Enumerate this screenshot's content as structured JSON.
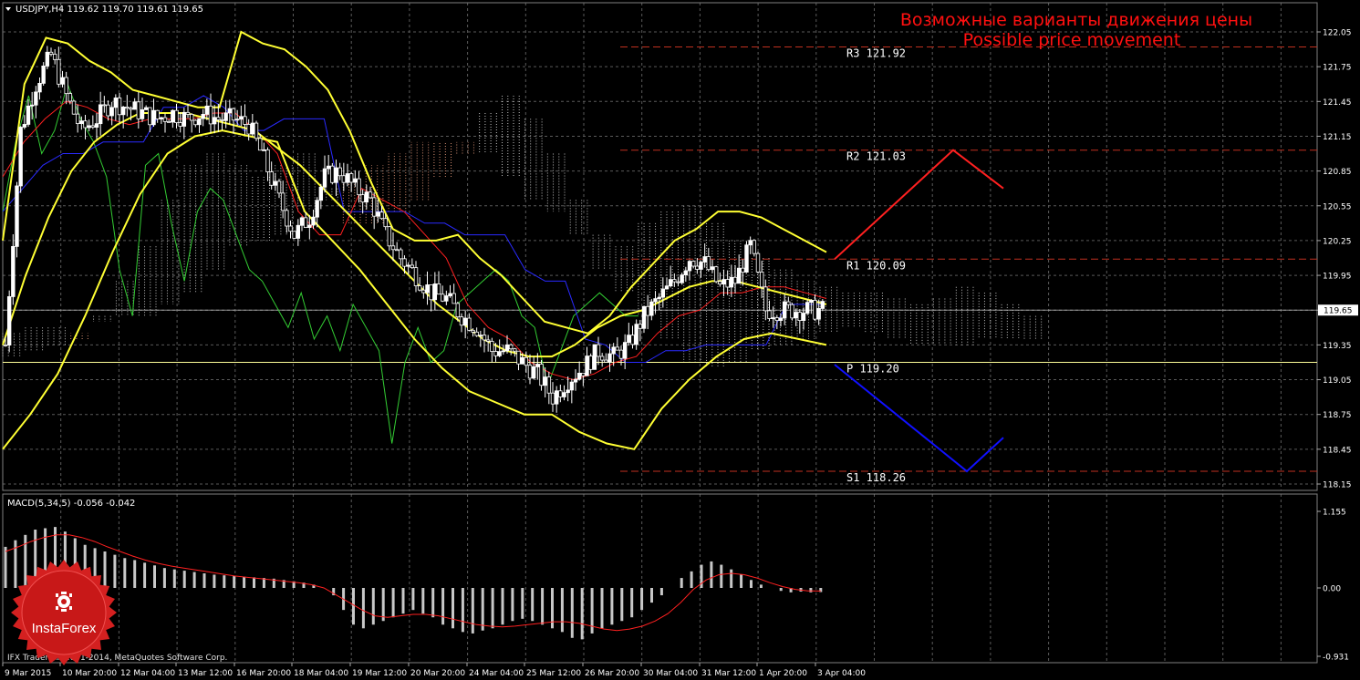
{
  "header": {
    "symbol_line": "USDJPY,H4  119.62 119.70 119.61 119.65",
    "annotation_ru": "Возможные варианты движения цены",
    "annotation_en": "Possible price movement"
  },
  "footer": {
    "copyright": "IFX Trader, © 2001-2014, MetaQuotes Software Corp.",
    "logo_text": "InstaForex"
  },
  "macd": {
    "label": "MACD(5,34,5) -0.056 -0.042",
    "y_ticks": [
      "1.155",
      "0.00",
      "-0.931"
    ],
    "y_values": [
      1.155,
      0.0,
      -0.931
    ]
  },
  "colors": {
    "background": "#000000",
    "grid": "#5a5a5a",
    "bull_candle": "#ffffff",
    "bear_candle": "#000000",
    "bollinger": "#ffff33",
    "tenkan": "#ff2020",
    "kijun": "#2a2aff",
    "chikou": "#33cc33",
    "cloud_a": "#f0a080",
    "cloud_b": "#d8d8d8",
    "level_line": "#c03020",
    "annotation": "#ff1010",
    "up_scenario": "#ff2020",
    "down_scenario": "#1010ff",
    "price_line": "#c8c8c8",
    "pivot_line": "#ffff99",
    "macd_hist": "#c8c8c8",
    "macd_signal": "#ff2020",
    "logo_red": "#d42020"
  },
  "chart_data": [
    {
      "type": "candlestick",
      "symbol": "USDJPY",
      "timeframe": "H4",
      "ohlc_current": {
        "open": 119.62,
        "high": 119.7,
        "low": 119.61,
        "close": 119.65
      },
      "current_price": 119.65,
      "current_price_label": "119.65",
      "ylim": [
        118.09,
        122.15
      ],
      "y_ticks": [
        "122.05",
        "121.75",
        "121.45",
        "121.15",
        "120.85",
        "120.55",
        "120.25",
        "119.95",
        "119.65",
        "119.35",
        "119.05",
        "118.75",
        "118.45",
        "118.15"
      ],
      "y_tick_values": [
        122.05,
        121.75,
        121.45,
        121.15,
        120.85,
        120.55,
        120.25,
        119.95,
        119.65,
        119.35,
        119.05,
        118.75,
        118.45,
        118.15
      ],
      "x_ticks": [
        "9 Mar 2015",
        "10 Mar 20:00",
        "12 Mar 04:00",
        "13 Mar 12:00",
        "16 Mar 20:00",
        "18 Mar 04:00",
        "19 Mar 12:00",
        "20 Mar 20:00",
        "24 Mar 04:00",
        "25 Mar 12:00",
        "26 Mar 20:00",
        "30 Mar 04:00",
        "31 Mar 12:00",
        "1 Apr 20:00",
        "3 Apr 04:00"
      ],
      "levels": [
        {
          "name": "R3",
          "label": "R3 121.92",
          "value": 121.92
        },
        {
          "name": "R2",
          "label": "R2 121.03",
          "value": 121.03
        },
        {
          "name": "R1",
          "label": "R1 120.09",
          "value": 120.09
        },
        {
          "name": "P",
          "label": "P 119.20",
          "value": 119.2
        },
        {
          "name": "S1",
          "label": "S1 118.26",
          "value": 118.26
        }
      ],
      "close_path": [
        119.35,
        121.2,
        121.6,
        121.85,
        121.5,
        121.2,
        121.3,
        121.45,
        121.4,
        121.35,
        121.3,
        121.35,
        121.3,
        121.35,
        121.3,
        121.3,
        121.25,
        120.95,
        120.6,
        120.3,
        120.45,
        120.8,
        120.85,
        120.7,
        120.6,
        120.3,
        120.1,
        119.95,
        119.8,
        119.75,
        119.6,
        119.5,
        119.3,
        119.3,
        119.2,
        119.1,
        118.9,
        119.05,
        119.15,
        119.3,
        119.25,
        119.35,
        119.6,
        119.75,
        119.9,
        120.1,
        120.05,
        119.85,
        119.9,
        120.2,
        119.65,
        119.65,
        119.65,
        119.65,
        119.65
      ],
      "bollinger_upper": [
        120.25,
        121.6,
        122.0,
        121.95,
        121.8,
        121.7,
        121.55,
        121.5,
        121.45,
        121.4,
        121.4,
        122.05,
        121.95,
        121.9,
        121.75,
        121.55,
        121.2,
        120.75,
        120.35,
        120.25,
        120.25,
        120.3,
        120.1,
        119.95,
        119.75,
        119.55,
        119.5,
        119.45,
        119.6,
        119.85,
        120.05,
        120.25,
        120.35,
        120.5,
        120.5,
        120.45,
        120.35,
        120.25,
        120.15
      ],
      "bollinger_middle": [
        119.35,
        119.95,
        120.45,
        120.85,
        121.1,
        121.25,
        121.35,
        121.35,
        121.35,
        121.3,
        121.25,
        121.2,
        121.05,
        120.9,
        120.7,
        120.5,
        120.3,
        120.1,
        119.9,
        119.7,
        119.55,
        119.4,
        119.3,
        119.25,
        119.25,
        119.35,
        119.5,
        119.6,
        119.65,
        119.75,
        119.85,
        119.9,
        119.9,
        119.85,
        119.8,
        119.75,
        119.7
      ],
      "bollinger_lower": [
        118.45,
        118.75,
        119.1,
        119.6,
        120.15,
        120.65,
        121.0,
        121.15,
        121.2,
        121.15,
        121.1,
        120.5,
        120.25,
        120.0,
        119.7,
        119.4,
        119.15,
        118.95,
        118.85,
        118.75,
        118.75,
        118.6,
        118.5,
        118.45,
        118.8,
        119.05,
        119.25,
        119.4,
        119.45,
        119.4,
        119.35
      ],
      "scenarios": [
        {
          "name": "up",
          "points": [
            [
              119.9,
              120.09
            ],
            [
              1045,
              121.03
            ],
            [
              1100,
              120.7
            ]
          ]
        },
        {
          "name": "down",
          "points": [
            [
              119.9,
              119.18
            ],
            [
              1060,
              118.26
            ],
            [
              1100,
              118.55
            ]
          ]
        }
      ]
    },
    {
      "type": "bar",
      "title": "MACD(5,34,5) -0.056 -0.042",
      "macd_value": -0.056,
      "signal_value": -0.042,
      "ylim": [
        -0.931,
        1.155
      ],
      "histogram": [
        0.62,
        0.72,
        0.8,
        0.88,
        0.9,
        0.92,
        0.85,
        0.75,
        0.65,
        0.6,
        0.55,
        0.5,
        0.45,
        0.42,
        0.38,
        0.34,
        0.3,
        0.28,
        0.26,
        0.24,
        0.22,
        0.2,
        0.19,
        0.18,
        0.17,
        0.16,
        0.15,
        0.14,
        0.12,
        0.1,
        0.08,
        0.05,
        0.0,
        -0.1,
        -0.3,
        -0.5,
        -0.55,
        -0.5,
        -0.45,
        -0.4,
        -0.35,
        -0.3,
        -0.35,
        -0.4,
        -0.5,
        -0.55,
        -0.6,
        -0.62,
        -0.58,
        -0.55,
        -0.5,
        -0.45,
        -0.42,
        -0.45,
        -0.5,
        -0.55,
        -0.6,
        -0.68,
        -0.7,
        -0.62,
        -0.55,
        -0.5,
        -0.45,
        -0.4,
        -0.3,
        -0.2,
        -0.1,
        0.0,
        0.15,
        0.25,
        0.35,
        0.4,
        0.35,
        0.28,
        0.2,
        0.12,
        0.05,
        0.0,
        -0.04,
        -0.06,
        -0.05,
        -0.06,
        -0.056
      ],
      "signal": [
        0.55,
        0.62,
        0.7,
        0.76,
        0.8,
        0.8,
        0.76,
        0.7,
        0.62,
        0.55,
        0.48,
        0.42,
        0.37,
        0.33,
        0.3,
        0.27,
        0.24,
        0.21,
        0.18,
        0.16,
        0.14,
        0.12,
        0.1,
        0.08,
        0.05,
        0.0,
        -0.1,
        -0.2,
        -0.3,
        -0.38,
        -0.4,
        -0.38,
        -0.36,
        -0.36,
        -0.38,
        -0.42,
        -0.46,
        -0.5,
        -0.52,
        -0.53,
        -0.52,
        -0.5,
        -0.48,
        -0.46,
        -0.46,
        -0.48,
        -0.52,
        -0.56,
        -0.58,
        -0.56,
        -0.52,
        -0.45,
        -0.35,
        -0.2,
        -0.02,
        0.12,
        0.2,
        0.22,
        0.2,
        0.15,
        0.08,
        0.02,
        -0.02,
        -0.04,
        -0.042
      ]
    }
  ]
}
